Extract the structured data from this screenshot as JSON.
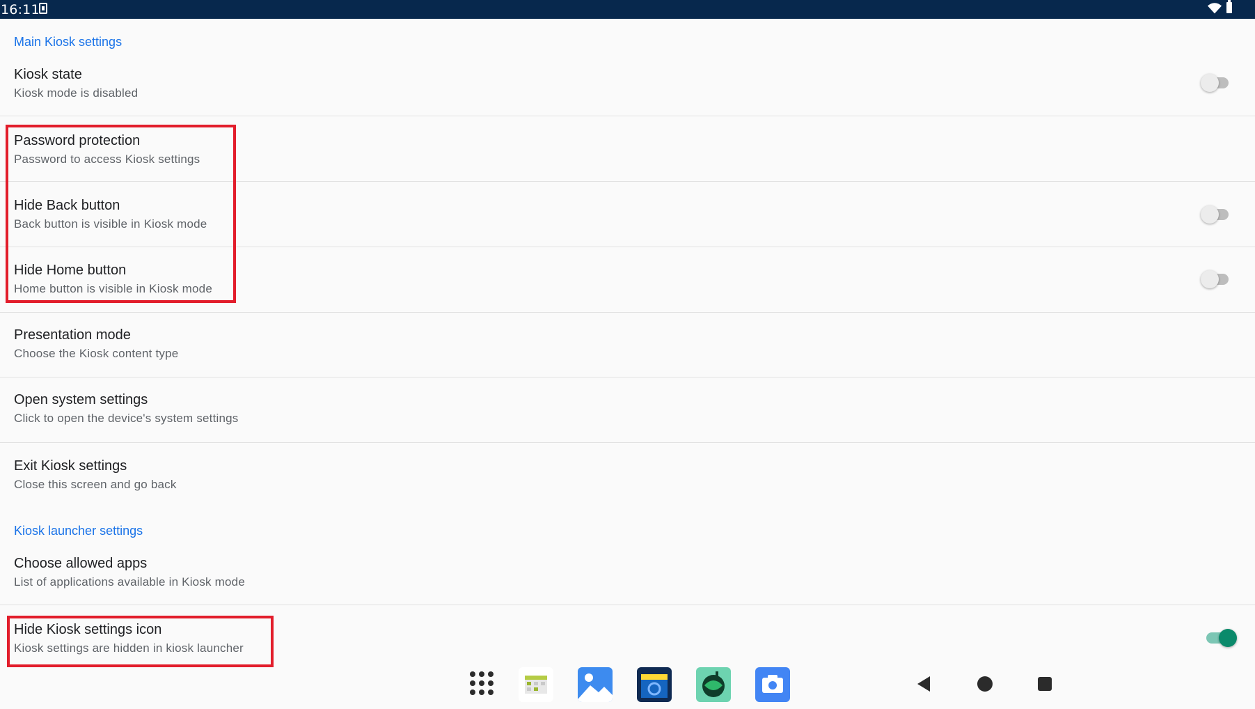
{
  "status_bar": {
    "time": "16:11"
  },
  "sections": {
    "main_header": "Main Kiosk settings",
    "launcher_header": "Kiosk launcher settings"
  },
  "prefs": {
    "kiosk_state": {
      "title": "Kiosk state",
      "summary": "Kiosk mode is disabled",
      "switch_on": false
    },
    "password": {
      "title": "Password protection",
      "summary": "Password to access Kiosk settings"
    },
    "hide_back": {
      "title": "Hide Back button",
      "summary": "Back button is visible in Kiosk mode",
      "switch_on": false
    },
    "hide_home": {
      "title": "Hide Home button",
      "summary": "Home button is visible in Kiosk mode",
      "switch_on": false
    },
    "presentation": {
      "title": "Presentation mode",
      "summary": "Choose the Kiosk content type"
    },
    "system_settings": {
      "title": "Open system settings",
      "summary": "Click to open the device's system settings"
    },
    "exit": {
      "title": "Exit Kiosk settings",
      "summary": "Close this screen and go back"
    },
    "allowed_apps": {
      "title": "Choose allowed apps",
      "summary": "List of applications available in Kiosk mode"
    },
    "hide_icon": {
      "title": "Hide Kiosk settings icon",
      "summary": "Kiosk settings are hidden in kiosk launcher",
      "switch_on": true
    }
  },
  "taskbar": {
    "apps": [
      "app-drawer-icon",
      "calendar-app-icon",
      "gallery-app-icon",
      "kiosk-camera-app-icon",
      "green-app-icon",
      "camera-app-icon"
    ],
    "nav": [
      "back-icon",
      "home-icon",
      "recents-icon"
    ]
  },
  "colors": {
    "status_bar": "#07284d",
    "accent": "#1a73e8",
    "highlight": "#e21d2b",
    "switch_on": "#0b8a6b"
  }
}
